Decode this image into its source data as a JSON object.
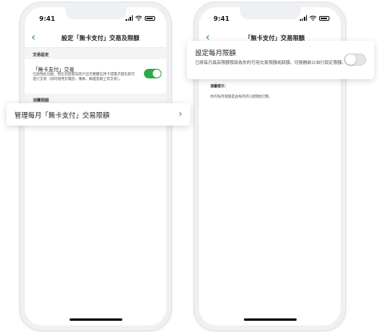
{
  "colors": {
    "accent": "#2daa4b",
    "back_arrow": "#1e9e4a"
  },
  "icons": {
    "back": "chevron-left-icon",
    "forward": "chevron-right-icon",
    "wifi": "wifi-icon",
    "signal": "signal-icon",
    "battery": "battery-icon"
  },
  "left_phone": {
    "status": {
      "time": "9:41"
    },
    "nav": {
      "back": "‹",
      "title": "設定「無卡支付」交易及限額"
    },
    "section_transactions": {
      "header": "交易設定"
    },
    "cardless_row": {
      "title": "「無卡支付」交易",
      "description": "已啟用此功能，現在您無需向商戶出示實體信用卡或電子錢包即可進行交易（同時適用於電話、傳真、郵遞及網上等交易）。",
      "toggle_on": true
    },
    "section_limits": {
      "header": "消費限額"
    },
    "highlight_card": {
      "label": "管理每月「無卡支付」交易限額",
      "chevron": "›"
    }
  },
  "right_phone": {
    "status": {
      "time": "9:41"
    },
    "nav": {
      "back": "‹",
      "title": "「無卡支付」交易限額"
    },
    "note_label": "溫馨提示：",
    "note_text": "你的每月限額是由每月的1號開始計算。",
    "highlight_card": {
      "title": "設定每月限額",
      "description": "已將每月最高限額預設為你的可用交易限額或餘額。切換開啟以自行設定限額。",
      "toggle_on": false
    }
  }
}
